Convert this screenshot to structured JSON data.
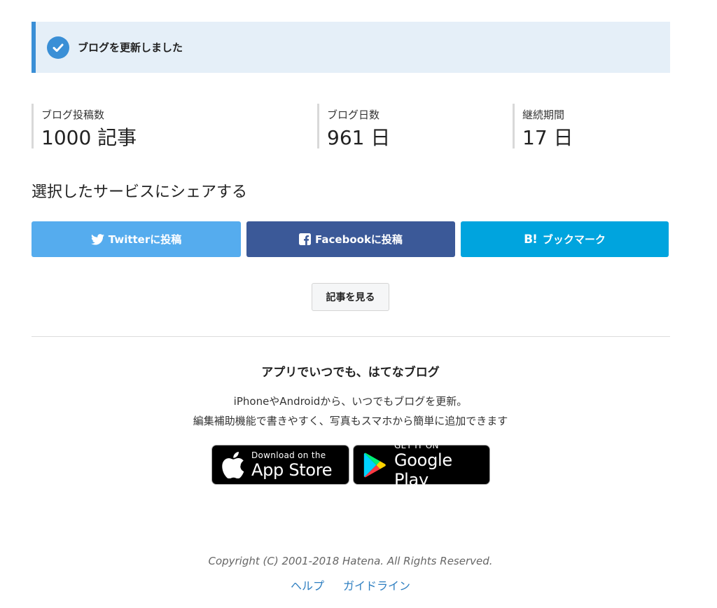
{
  "notice": {
    "message": "ブログを更新しました",
    "icon": "check-circle-icon",
    "accent": "#3a8fd6",
    "background": "#e5eff8"
  },
  "stats": [
    {
      "label": "ブログ投稿数",
      "value": "1000 記事"
    },
    {
      "label": "ブログ日数",
      "value": "961 日"
    },
    {
      "label": "継続期間",
      "value": "17 日"
    }
  ],
  "share": {
    "heading": "選択したサービスにシェアする",
    "twitter": {
      "label": "Twitterに投稿",
      "icon": "twitter-bird-icon",
      "color": "#55acee"
    },
    "facebook": {
      "label": "Facebookに投稿",
      "icon": "facebook-f-icon",
      "color": "#3b5998"
    },
    "hatena": {
      "label": "ブックマーク",
      "mark": "B!",
      "icon": "hatena-bookmark-icon",
      "color": "#00a4de"
    }
  },
  "view_article": {
    "label": "記事を見る"
  },
  "app_promo": {
    "title": "アプリでいつでも、はてなブログ",
    "desc_line1": "iPhoneやAndroidから、いつでもブログを更新。",
    "desc_line2": "編集補助機能で書きやすく、写真もスマホから簡単に追加できます",
    "app_store": {
      "small": "Download on the",
      "big": "App Store",
      "icon": "apple-icon"
    },
    "google_play": {
      "small": "GET IT ON",
      "big": "Google Play",
      "icon": "google-play-icon"
    }
  },
  "footer": {
    "copyright": "Copyright (C) 2001-2018 Hatena. All Rights Reserved.",
    "links": [
      {
        "label": "ヘルプ"
      },
      {
        "label": "ガイドライン"
      }
    ],
    "link_color": "#2f7fc1"
  }
}
